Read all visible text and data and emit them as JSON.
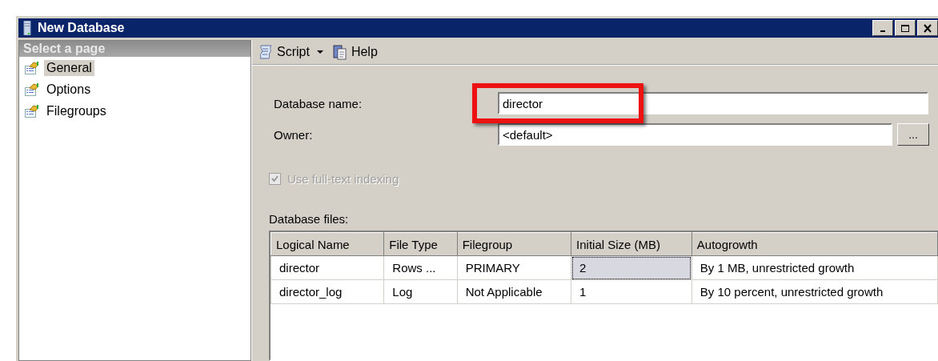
{
  "window": {
    "title": "New Database",
    "controls": [
      {
        "kind": "minimize"
      },
      {
        "kind": "maximize"
      },
      {
        "kind": "close"
      }
    ]
  },
  "sidebar": {
    "header": "Select a page",
    "items": [
      {
        "label": "General",
        "selected": true
      },
      {
        "label": "Options",
        "selected": false
      },
      {
        "label": "Filegroups",
        "selected": false
      }
    ]
  },
  "toolbar": [
    {
      "kind": "script",
      "label": "Script",
      "dropdown": true
    },
    {
      "kind": "help",
      "label": "Help",
      "dropdown": false
    }
  ],
  "form": {
    "database_name": {
      "label": "Database name:",
      "value": "director",
      "highlighted": true
    },
    "owner": {
      "label": "Owner:",
      "value": "<default>",
      "browse": "..."
    },
    "fulltext": {
      "label": "Use full-text indexing",
      "checked": true,
      "disabled": true
    }
  },
  "table": {
    "label": "Database files:",
    "columns": [
      "Logical Name",
      "File Type",
      "Filegroup",
      "Initial Size (MB)",
      "Autogrowth"
    ],
    "rows": [
      {
        "cells": [
          {
            "text": "director",
            "selected": false
          },
          {
            "text": "Rows ...",
            "selected": false
          },
          {
            "text": "PRIMARY",
            "selected": false
          },
          {
            "text": "2",
            "selected": true
          },
          {
            "text": "By 1 MB, unrestricted growth",
            "selected": false
          }
        ]
      },
      {
        "cells": [
          {
            "text": "director_log",
            "selected": false
          },
          {
            "text": "Log",
            "selected": false
          },
          {
            "text": "Not Applicable",
            "selected": false
          },
          {
            "text": "1",
            "selected": false
          },
          {
            "text": "By 10 percent, unrestricted growth",
            "selected": false
          }
        ]
      }
    ]
  }
}
